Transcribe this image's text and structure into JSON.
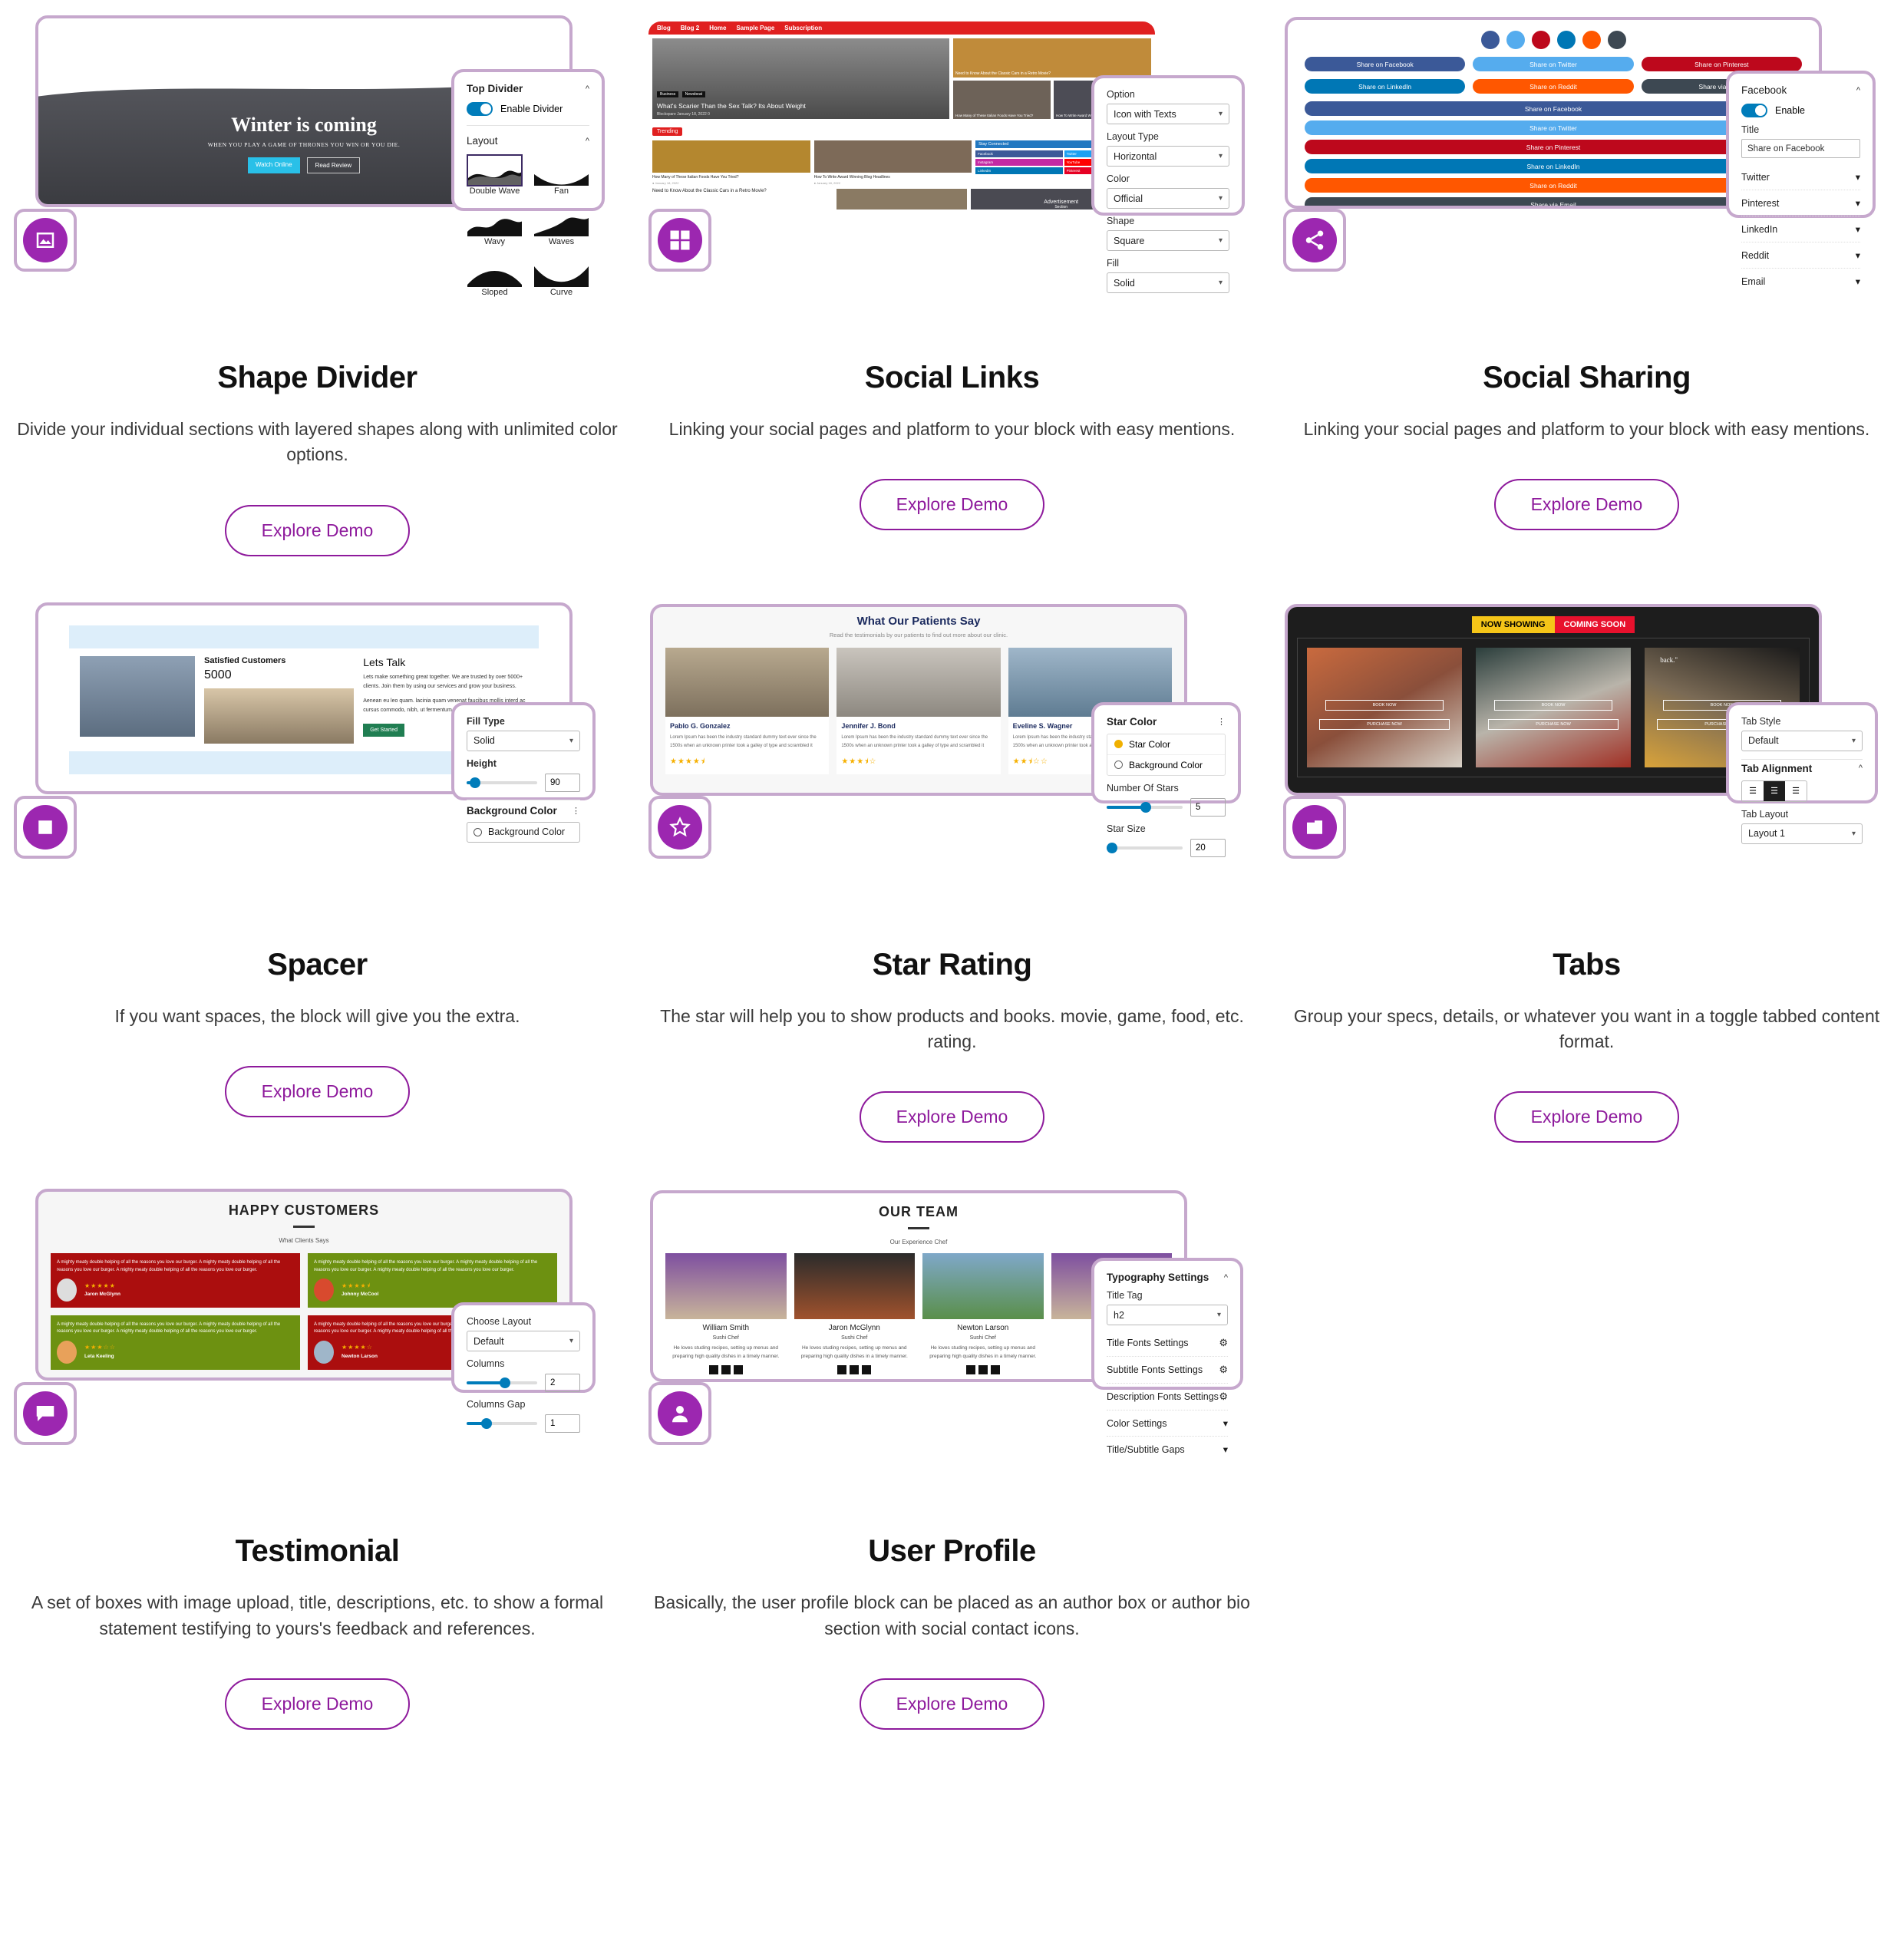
{
  "cards": [
    {
      "id": "shape-divider",
      "badge_icon": "image-icon",
      "title": "Shape Divider",
      "description": "Divide your individual sections with layered shapes along with unlimited color options.",
      "cta": "Explore Demo",
      "preview": {
        "hero_title": "Winter is coming",
        "hero_subtitle": "WHEN YOU PLAY A GAME OF THRONES YOU WIN OR YOU DIE.",
        "btn_primary": "Watch Online",
        "btn_secondary": "Read Review"
      },
      "panel": {
        "section_title": "Top Divider",
        "toggle_label": "Enable Divider",
        "toggle_on": true,
        "layout_label": "Layout",
        "layouts": [
          "Double Wave",
          "Fan",
          "Wavy",
          "Waves",
          "Sloped",
          "Curve"
        ],
        "selected_layout": "Double Wave"
      }
    },
    {
      "id": "social-links",
      "badge_icon": "social-icons-grid-icon",
      "title": "Social Links",
      "description": "Linking your social pages and platform to your block with easy mentions.",
      "cta": "Explore Demo",
      "preview": {
        "nav": [
          "Blog",
          "Blog 2",
          "Home",
          "Sample Page",
          "Subscription"
        ],
        "feature_tags": [
          "Business",
          "Newsbeat"
        ],
        "feature_title": "What's Scarier Than the Sex Talk? Its About Weight",
        "feature_meta": "Blockspare   January 18, 2022   0",
        "trending_label": "Trending",
        "stay_connected": "Stay Connected",
        "socials": [
          "Facebook",
          "Twitter",
          "Instagram",
          "YouTube",
          "LinkedIn",
          "Pinterest"
        ],
        "cards": [
          "Need to Know About the Classic Cars in a Retro Movie?",
          "How Many of These Italian Foods Have You Tried?",
          "How To Write Award Winning Blog Headlines"
        ],
        "bottom_card": "Need to Know About the Classic Cars in a Retro Movie?",
        "ad_label": "Advertisement",
        "ad_sub": "Section"
      },
      "panel": {
        "fields": [
          {
            "label": "Option",
            "value": "Icon with Texts"
          },
          {
            "label": "Layout Type",
            "value": "Horizontal"
          },
          {
            "label": "Color",
            "value": "Official"
          },
          {
            "label": "Shape",
            "value": "Square"
          },
          {
            "label": "Fill",
            "value": "Solid"
          }
        ]
      }
    },
    {
      "id": "social-sharing",
      "badge_icon": "share-icon",
      "title": "Social Sharing",
      "description": "Linking your social pages and platform to your block with easy mentions.",
      "cta": "Explore Demo",
      "preview": {
        "round_icons": [
          "facebook",
          "twitter",
          "pinterest",
          "linkedin",
          "reddit",
          "email"
        ],
        "pill_row_1": [
          "Share on Facebook",
          "Share on Twitter",
          "Share on Pinterest"
        ],
        "pill_row_2": [
          "Share on LinkedIn",
          "Share on Reddit",
          "Share via Email"
        ],
        "full_buttons": [
          "Share on Facebook",
          "Share on Twitter",
          "Share on Pinterest",
          "Share on LinkedIn",
          "Share on Reddit",
          "Share via Email"
        ]
      },
      "panel": {
        "section_title": "Facebook",
        "toggle_label": "Enable",
        "toggle_on": true,
        "title_label": "Title",
        "title_value": "Share on Facebook",
        "accordions": [
          "Twitter",
          "Pinterest",
          "LinkedIn",
          "Reddit",
          "Email"
        ]
      }
    },
    {
      "id": "spacer",
      "badge_icon": "spacer-square-icon",
      "title": "Spacer",
      "description": "If you want spaces, the block will give you the extra.",
      "cta": "Explore Demo",
      "preview": {
        "stat_label": "Satisfied Customers",
        "stat_value": "5000",
        "heading": "Lets Talk",
        "body1": "Lets make something great together. We are trusted by over 5000+ clients. Join them by using our services and grow your business.",
        "body2": "Aenean eu leo quam. lacinia quam venenat faucibus mollis interd ac cursus commodo, nibh, ut fermentum m",
        "button": "Get Started"
      },
      "panel": {
        "fill_label": "Fill Type",
        "fill_value": "Solid",
        "height_label": "Height",
        "height_value": "90",
        "bg_header": "Background Color",
        "bg_option": "Background Color"
      }
    },
    {
      "id": "star-rating",
      "badge_icon": "star-icon",
      "title": "Star Rating",
      "description": "The star will help you to show products and books. movie, game, food, etc. rating.",
      "cta": "Explore Demo",
      "preview": {
        "heading": "What Our Patients Say",
        "sub": "Read the testimonials by our patients to find out more about our clinic.",
        "people": [
          {
            "name": "Pablo G. Gonzalez",
            "text": "Lorem Ipsum has been the industry standard dummy text ever since the 1500s when an unknown printer took a galley of type and scrambled it",
            "stars": "★★★★⯨"
          },
          {
            "name": "Jennifer J. Bond",
            "text": "Lorem Ipsum has been the industry standard dummy text ever since the 1500s when an unknown printer took a galley of type and scrambled it",
            "stars": "★★★⯨☆"
          },
          {
            "name": "Eveline S. Wagner",
            "text": "Lorem Ipsum has been the industry standard dummy text ever since the 1500s when an unknown printer took a galley of type and scrambled it",
            "stars": "★★⯨☆☆"
          }
        ]
      },
      "panel": {
        "section_title": "Star Color",
        "radio_star": "Star Color",
        "radio_bg": "Background Color",
        "num_stars_label": "Number Of Stars",
        "num_stars_value": "5",
        "star_size_label": "Star Size",
        "star_size_value": "20"
      }
    },
    {
      "id": "tabs",
      "badge_icon": "tabs-icon",
      "title": "Tabs",
      "description": "Group your specs, details, or whatever you want in a toggle tabbed content format.",
      "cta": "Explore Demo",
      "preview": {
        "tab_active": "NOW SHOWING",
        "tab_inactive": "COMING SOON",
        "poster_btn_1": "BOOK NOW",
        "poster_btn_2": "PURCHASE NOW",
        "quote": "back.\""
      },
      "panel": {
        "style_label": "Tab Style",
        "style_value": "Default",
        "alignment_label": "Tab Alignment",
        "alignment_selected": "center",
        "layout_label": "Tab Layout",
        "layout_value": "Layout 1"
      }
    },
    {
      "id": "testimonial",
      "badge_icon": "speech-bubble-icon",
      "title": "Testimonial",
      "description": "A set of boxes with image upload, title, descriptions, etc. to show a formal statement testifying to yours's feedback and references.",
      "cta": "Explore Demo",
      "preview": {
        "heading": "HAPPY CUSTOMERS",
        "sub": "What Clients Says",
        "quote": "A mighty meaty double helping of all the reasons you love our burger. A mighty meaty double helping of all the reasons you love our burger. A mighty meaty double helping of all the reasons you love our burger.",
        "items": [
          {
            "name": "Jaron McGlynn",
            "stars": "★★★★★",
            "color": "#ab0e0e"
          },
          {
            "name": "Johnny McCool",
            "stars": "★★★★⯨",
            "color": "#6d9111"
          },
          {
            "name": "Leta Keeling",
            "stars": "★★★☆☆",
            "color": "#6d9111"
          },
          {
            "name": "Newton Larson",
            "stars": "★★★★☆",
            "color": "#ab0e0e"
          }
        ]
      },
      "panel": {
        "layout_label": "Choose Layout",
        "layout_value": "Default",
        "columns_label": "Columns",
        "columns_value": "2",
        "gap_label": "Columns Gap",
        "gap_value": "1"
      }
    },
    {
      "id": "user-profile",
      "badge_icon": "user-icon",
      "title": "User Profile",
      "description": "Basically, the user profile block can be placed as an author box or author bio section with social contact icons.",
      "cta": "Explore Demo",
      "preview": {
        "heading": "OUR TEAM",
        "sub": "Our Experience Chef",
        "members": [
          {
            "name": "William Smith",
            "role": "Sushi Chef",
            "bio": "He loves studing recipes, setting up menus and preparing high quality dishes in a timely manner."
          },
          {
            "name": "Jaron McGlynn",
            "role": "Sushi Chef",
            "bio": "He loves studing recipes, setting up menus and preparing high quality dishes in a timely manner."
          },
          {
            "name": "Newton Larson",
            "role": "Sushi Chef",
            "bio": "He loves studing recipes, setting up menus and preparing high quality dishes in a timely manner."
          }
        ]
      },
      "panel": {
        "section_title": "Typography Settings",
        "tag_label": "Title Tag",
        "tag_value": "h2",
        "rows": [
          "Title Fonts Settings",
          "Subtitle Fonts Settings",
          "Description Fonts Settings"
        ],
        "accordions": [
          "Color Settings",
          "Title/Subtitle Gaps"
        ]
      }
    }
  ],
  "colors": {
    "accent": "#8e1a9c",
    "badge": "#9c27b0",
    "frame_border": "#c6a8cd",
    "toggle_on": "#007cba"
  }
}
